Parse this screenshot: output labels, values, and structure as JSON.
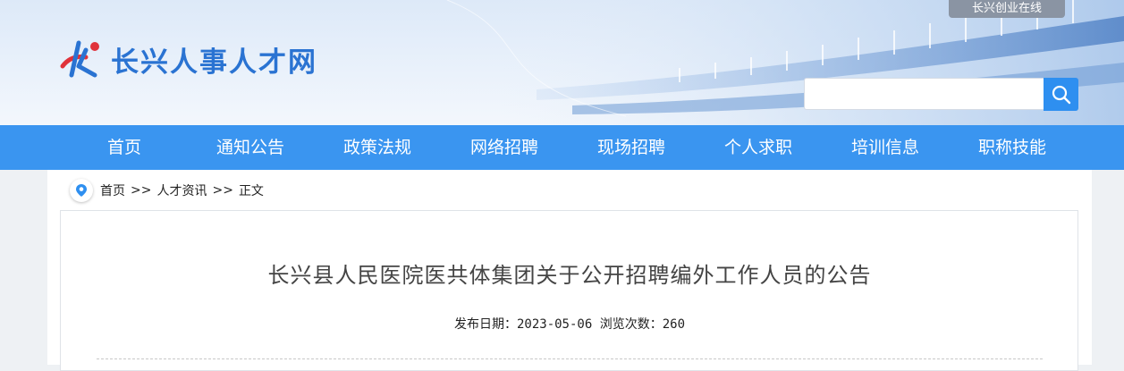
{
  "header": {
    "top_link": "长兴创业在线",
    "logo_text": "长兴人事人才网",
    "search": {
      "placeholder": "",
      "value": "",
      "icon": "search-icon"
    }
  },
  "nav": {
    "items": [
      {
        "label": "首页"
      },
      {
        "label": "通知公告"
      },
      {
        "label": "政策法规"
      },
      {
        "label": "网络招聘"
      },
      {
        "label": "现场招聘"
      },
      {
        "label": "个人求职"
      },
      {
        "label": "培训信息"
      },
      {
        "label": "职称技能"
      }
    ]
  },
  "breadcrumb": {
    "icon": "location-pin-icon",
    "items": [
      "首页",
      "人才资讯",
      "正文"
    ],
    "separator": ">>"
  },
  "article": {
    "title": "长兴县人民医院医共体集团关于公开招聘编外工作人员的公告",
    "date_label": "发布日期：",
    "date": "2023-05-06",
    "views_label": "浏览次数：",
    "views": "260"
  },
  "colors": {
    "nav_bg": "#3a95f0",
    "accent": "#2e8ff0",
    "logo_blue": "#2a73d2",
    "logo_red": "#e0323a"
  }
}
